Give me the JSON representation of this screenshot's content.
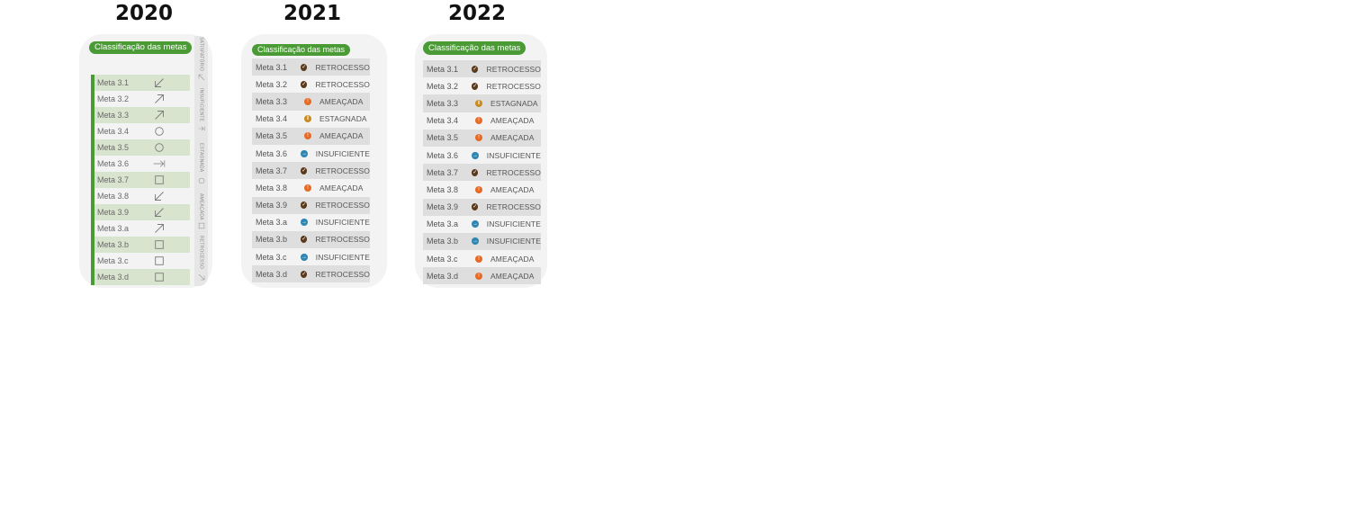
{
  "years": [
    "2020",
    "2021",
    "2022"
  ],
  "badge_label": "Classificação das metas",
  "status_colors": {
    "RETROCESSO": "#5a3a1a",
    "AMEAÇADA": "#e56a25",
    "ESTAGNADA": "#c98a1f",
    "INSUFICIENTE": "#2f86b3"
  },
  "y2020": {
    "legend": [
      {
        "label": "SATISFATÓRIO",
        "icon": "arrow-up-left-icon"
      },
      {
        "label": "INSUFICIENTE",
        "icon": "arrow-right-icon"
      },
      {
        "label": "ESTAGNADA",
        "icon": "circle-icon"
      },
      {
        "label": "AMEAÇADA",
        "icon": "square-icon"
      },
      {
        "label": "RETROCESSO",
        "icon": "arrow-down-right-icon"
      }
    ],
    "rows": [
      {
        "meta": "Meta 3.1",
        "icon": "arrow-down-left-icon"
      },
      {
        "meta": "Meta 3.2",
        "icon": "arrow-up-right-icon"
      },
      {
        "meta": "Meta 3.3",
        "icon": "arrow-up-right-icon"
      },
      {
        "meta": "Meta 3.4",
        "icon": "circle-icon"
      },
      {
        "meta": "Meta 3.5",
        "icon": "circle-icon"
      },
      {
        "meta": "Meta 3.6",
        "icon": "arrow-right-bar-icon"
      },
      {
        "meta": "Meta 3.7",
        "icon": "square-icon"
      },
      {
        "meta": "Meta 3.8",
        "icon": "arrow-down-left-icon"
      },
      {
        "meta": "Meta 3.9",
        "icon": "arrow-down-left-icon"
      },
      {
        "meta": "Meta 3.a",
        "icon": "arrow-up-right-icon"
      },
      {
        "meta": "Meta 3.b",
        "icon": "square-icon"
      },
      {
        "meta": "Meta 3.c",
        "icon": "square-icon"
      },
      {
        "meta": "Meta 3.d",
        "icon": "square-icon"
      }
    ]
  },
  "y2021": {
    "rows": [
      {
        "meta": "Meta 3.1",
        "status": "RETROCESSO"
      },
      {
        "meta": "Meta 3.2",
        "status": "RETROCESSO"
      },
      {
        "meta": "Meta 3.3",
        "status": "AMEAÇADA"
      },
      {
        "meta": "Meta 3.4",
        "status": "ESTAGNADA"
      },
      {
        "meta": "Meta 3.5",
        "status": "AMEAÇADA"
      },
      {
        "meta": "Meta 3.6",
        "status": "INSUFICIENTE"
      },
      {
        "meta": "Meta 3.7",
        "status": "RETROCESSO"
      },
      {
        "meta": "Meta 3.8",
        "status": "AMEAÇADA"
      },
      {
        "meta": "Meta 3.9",
        "status": "RETROCESSO"
      },
      {
        "meta": "Meta 3.a",
        "status": "INSUFICIENTE"
      },
      {
        "meta": "Meta 3.b",
        "status": "RETROCESSO"
      },
      {
        "meta": "Meta 3.c",
        "status": "INSUFICIENTE"
      },
      {
        "meta": "Meta 3.d",
        "status": "RETROCESSO"
      }
    ]
  },
  "y2022": {
    "rows": [
      {
        "meta": "Meta 3.1",
        "status": "RETROCESSO"
      },
      {
        "meta": "Meta 3.2",
        "status": "RETROCESSO"
      },
      {
        "meta": "Meta 3.3",
        "status": "ESTAGNADA"
      },
      {
        "meta": "Meta 3.4",
        "status": "AMEAÇADA"
      },
      {
        "meta": "Meta 3.5",
        "status": "AMEAÇADA"
      },
      {
        "meta": "Meta 3.6",
        "status": "INSUFICIENTE"
      },
      {
        "meta": "Meta 3.7",
        "status": "RETROCESSO"
      },
      {
        "meta": "Meta 3.8",
        "status": "AMEAÇADA"
      },
      {
        "meta": "Meta 3.9",
        "status": "RETROCESSO"
      },
      {
        "meta": "Meta 3.a",
        "status": "INSUFICIENTE"
      },
      {
        "meta": "Meta 3.b",
        "status": "INSUFICIENTE"
      },
      {
        "meta": "Meta 3.c",
        "status": "AMEAÇADA"
      },
      {
        "meta": "Meta 3.d",
        "status": "AMEAÇADA"
      }
    ]
  }
}
